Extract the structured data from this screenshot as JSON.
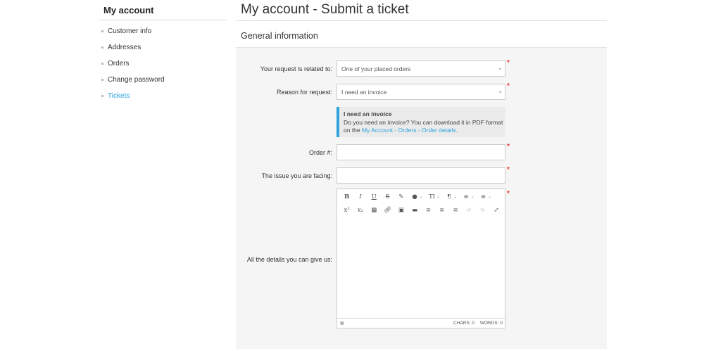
{
  "sidebar": {
    "title": "My account",
    "items": [
      {
        "label": "Customer info"
      },
      {
        "label": "Addresses"
      },
      {
        "label": "Orders"
      },
      {
        "label": "Change password"
      },
      {
        "label": "Tickets",
        "active": true
      }
    ]
  },
  "main": {
    "title": "My account - Submit a ticket",
    "section_title": "General information",
    "form": {
      "related_label": "Your request is related to:",
      "related_value": "One of your placed orders",
      "reason_label": "Reason for request:",
      "reason_value": "I need an invoice",
      "info_title": "I need an invoice",
      "info_text": "Do you need an invoice? You can download it in PDF format on the",
      "info_link": "My Account - Orders - Order details",
      "info_end": ".",
      "order_label": "Order #:",
      "issue_label": "The issue you are facing:",
      "details_label": "All the details you can give us:",
      "required_mark": "*"
    },
    "editor": {
      "toolbar_row1": [
        "B",
        "I",
        "U",
        "S",
        "eraser",
        "color",
        "TI",
        "¶",
        "bullet-list",
        "numbered-list"
      ],
      "toolbar_row2": [
        "x²",
        "x₂",
        "table",
        "link",
        "image",
        "video",
        "align-left",
        "align-center",
        "align-right",
        "undo",
        "redo",
        "fullscreen"
      ],
      "chars": "CHARS: 0",
      "words": "WORDS: 0"
    }
  },
  "colors": {
    "accent": "#2ea3dd",
    "required": "#e53935",
    "form_bg": "#f5f5f5"
  }
}
